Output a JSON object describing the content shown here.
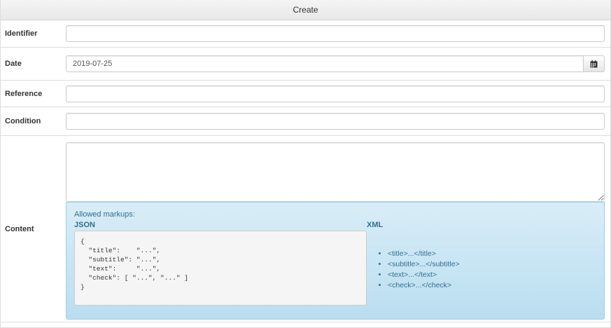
{
  "header": {
    "title": "Create"
  },
  "form": {
    "identifier": {
      "label": "Identifier",
      "value": ""
    },
    "date": {
      "label": "Date",
      "value": "2019-07-25"
    },
    "reference": {
      "label": "Reference",
      "value": ""
    },
    "condition": {
      "label": "Condition",
      "value": ""
    },
    "content": {
      "label": "Content",
      "value": ""
    }
  },
  "markups": {
    "title": "Allowed markups:",
    "json_heading": "JSON",
    "json_example": "{\n  \"title\":    \"...\",\n  \"subtitle\": \"...\",\n  \"text\":     \"...\",\n  \"check\": [ \"...\", \"...\" ]\n}",
    "xml_heading": "XML",
    "xml_items": [
      "<title>...</title>",
      "<subtitle>...</subtitle>",
      "<text>...</text>",
      "<check>...</check>"
    ]
  },
  "icons": {
    "calendar_button": "calendar-icon"
  },
  "colors": {
    "info_text": "#31708f",
    "info_bg": "#d9edf7",
    "info_border": "#9acfea"
  }
}
